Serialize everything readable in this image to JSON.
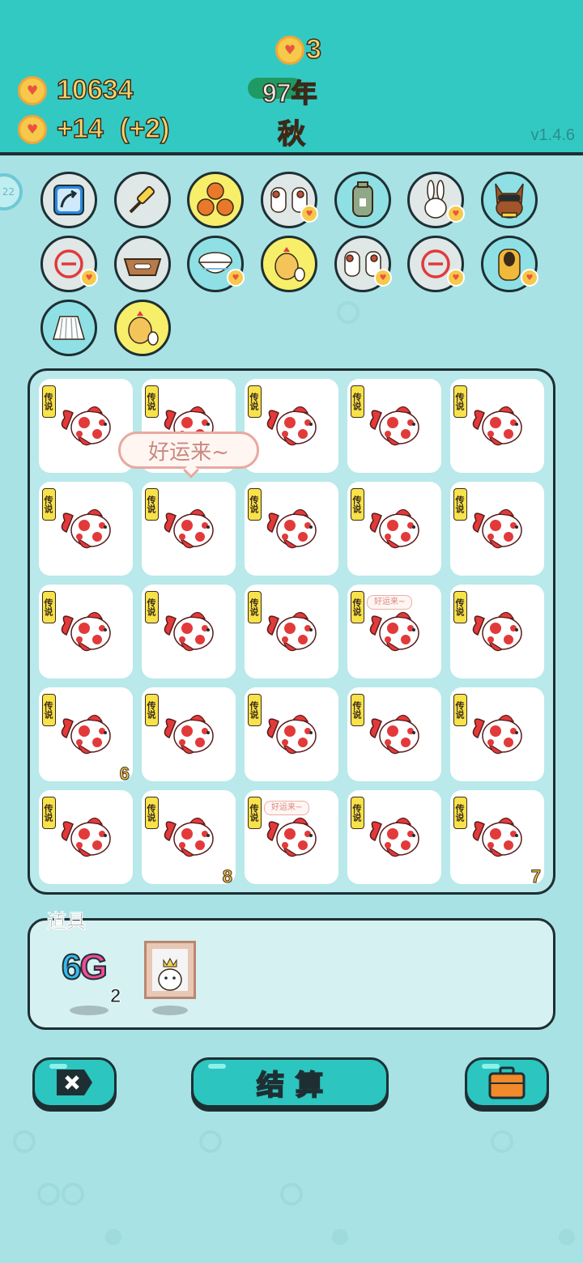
{
  "header": {
    "top_coins": "3",
    "money": "10634",
    "income": "+14",
    "income_bonus": "(+2)",
    "year": "97年",
    "season": "秋",
    "version": "v1.4.6"
  },
  "edge_badge": "22",
  "items_row1": [
    {
      "icon": "swap-arrow-icon",
      "bg": "#dfe7e7",
      "coin": false
    },
    {
      "icon": "screwdriver-icon",
      "bg": "#dfe7e7",
      "coin": false
    },
    {
      "icon": "basketballs-icon",
      "bg": "#f7ee6a",
      "coin": false
    },
    {
      "icon": "cow-pair-icon",
      "bg": "#dfe7e7",
      "coin": true
    },
    {
      "icon": "sack-icon",
      "bg": "#8fe0e4",
      "coin": false
    },
    {
      "icon": "rabbit-icon",
      "bg": "#dfe7e7",
      "coin": true
    },
    {
      "icon": "sunglasses-dog-icon",
      "bg": "#8fe0e4",
      "coin": false
    }
  ],
  "items_row2": [
    {
      "icon": "minus-circle-icon",
      "bg": "#dfe7e7",
      "coin": true
    },
    {
      "icon": "dog-bowl-icon",
      "bg": "#dfe7e7",
      "coin": false
    },
    {
      "icon": "rice-bowl-icon",
      "bg": "#8fe0e4",
      "coin": true
    },
    {
      "icon": "chicken-egg-icon",
      "bg": "#f7ee6a",
      "coin": false
    },
    {
      "icon": "cow-pair-icon",
      "bg": "#dfe7e7",
      "coin": true
    },
    {
      "icon": "minus-circle-icon",
      "bg": "#dfe7e7",
      "coin": true
    },
    {
      "icon": "cheetah-icon",
      "bg": "#8fe0e4",
      "coin": true
    }
  ],
  "items_row3": [
    {
      "icon": "skirt-icon",
      "bg": "#8fe0e4",
      "coin": false
    },
    {
      "icon": "chicken-egg-icon",
      "bg": "#f7ee6a",
      "coin": false
    }
  ],
  "speech_bubble": "好运来~",
  "grid": {
    "tag": "传说",
    "mini_bubble": "好运来~",
    "cells": [
      {
        "num": "",
        "bubble": false
      },
      {
        "num": "",
        "bubble": false
      },
      {
        "num": "",
        "bubble": false
      },
      {
        "num": "",
        "bubble": false
      },
      {
        "num": "",
        "bubble": false
      },
      {
        "num": "",
        "bubble": false
      },
      {
        "num": "",
        "bubble": false
      },
      {
        "num": "",
        "bubble": false
      },
      {
        "num": "",
        "bubble": false
      },
      {
        "num": "",
        "bubble": false
      },
      {
        "num": "",
        "bubble": false
      },
      {
        "num": "",
        "bubble": false
      },
      {
        "num": "",
        "bubble": false
      },
      {
        "num": "",
        "bubble": true
      },
      {
        "num": "",
        "bubble": false
      },
      {
        "num": "6",
        "bubble": false
      },
      {
        "num": "",
        "bubble": false
      },
      {
        "num": "",
        "bubble": false
      },
      {
        "num": "",
        "bubble": false
      },
      {
        "num": "",
        "bubble": false
      },
      {
        "num": "",
        "bubble": false
      },
      {
        "num": "8",
        "bubble": false
      },
      {
        "num": "",
        "bubble": true
      },
      {
        "num": "",
        "bubble": false
      },
      {
        "num": "7",
        "bubble": false
      }
    ]
  },
  "tools": {
    "label": "道具",
    "g6_six": "6",
    "g6_g": "G",
    "g6_count": "2",
    "photo_icon": "husky-king-photo-icon"
  },
  "buttons": {
    "settle_label": "结算",
    "close_icon": "close-tag-icon",
    "bag_icon": "briefcase-icon"
  },
  "colors": {
    "header_bg": "#33c9c3",
    "page_bg": "#a9e2e4",
    "button": "#2cc5c0",
    "coin": "#f7c94a",
    "koi_red": "#e23a3a"
  }
}
